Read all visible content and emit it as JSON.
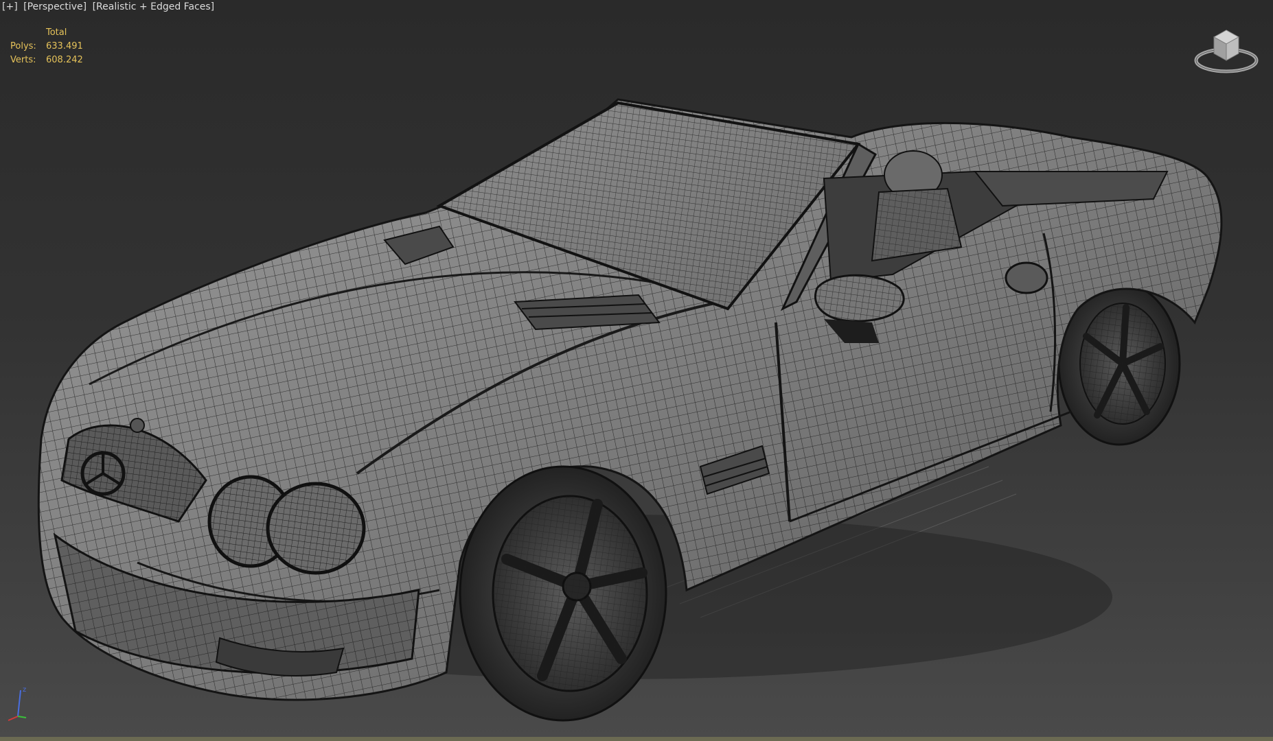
{
  "viewport": {
    "labels": [
      "[+]",
      "[Perspective]",
      "[Realistic + Edged Faces]"
    ]
  },
  "stats": {
    "header": "Total",
    "polys_label": "Polys:",
    "polys_value": "633.491",
    "verts_label": "Verts:",
    "verts_value": "608.242"
  },
  "axis": {
    "z_label": "z"
  },
  "colors": {
    "stats_text": "#e6c35a",
    "label_text": "#dcdcdc",
    "axis_x": "#d23a3a",
    "axis_y": "#3ac23a",
    "axis_z": "#4a6ee0"
  },
  "icons": {
    "viewcube": "viewcube-icon",
    "axis": "axis-tripod-icon"
  }
}
